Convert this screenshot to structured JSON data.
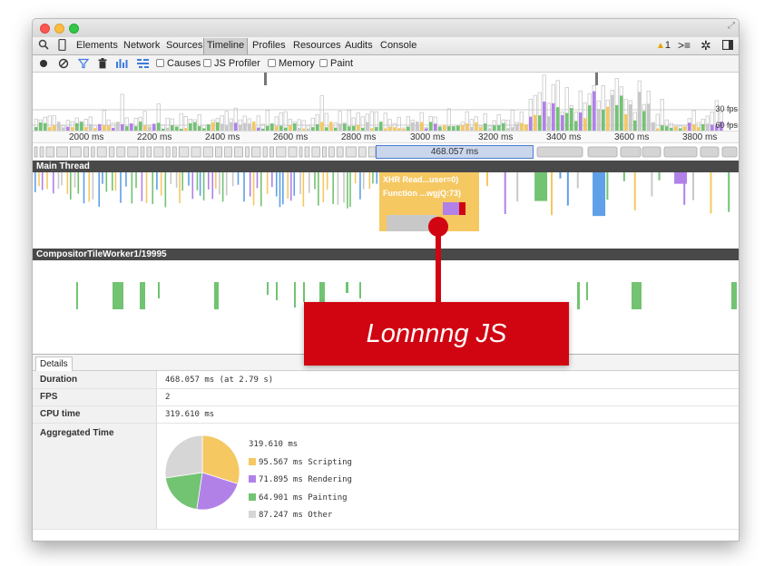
{
  "window": {
    "resize_icon": "resize-icon"
  },
  "tabs": [
    {
      "label": "Elements"
    },
    {
      "label": "Network"
    },
    {
      "label": "Sources"
    },
    {
      "label": "Timeline",
      "selected": true
    },
    {
      "label": "Profiles"
    },
    {
      "label": "Resources"
    },
    {
      "label": "Audits"
    },
    {
      "label": "Console"
    }
  ],
  "tabbar_right": {
    "warning_count": "1",
    "warning_icon": "warning-icon",
    "drawer_icon": "console-drawer-icon",
    "settings_icon": "gear-icon",
    "dock_icon": "dock-icon"
  },
  "toolbar": {
    "record_icon": "record-icon",
    "clear_icon": "clear-icon",
    "filter_icon": "filter-icon",
    "trash_icon": "trash-icon",
    "bars_icon": "bars-icon",
    "flame_icon": "flame-icon",
    "causes": "Causes",
    "js_profiler": "JS Profiler",
    "memory": "Memory",
    "paint": "Paint"
  },
  "overview": {
    "fps_30": "30 fps",
    "fps_60": "60 fps"
  },
  "ruler_ticks": [
    "2000 ms",
    "2200 ms",
    "2400 ms",
    "2600 ms",
    "2800 ms",
    "3000 ms",
    "3200 ms",
    "3400 ms",
    "3600 ms",
    "3800 ms"
  ],
  "selected_frame": "468.057 ms",
  "main_thread": {
    "title": "Main Thread",
    "event1": "XHR Read...user=0)",
    "event2": "Function ...wgjQ:73)"
  },
  "worker_thread": {
    "title": "CompositorTileWorker1/19995"
  },
  "callout": "Lonnnng JS",
  "details": {
    "tab": "Details",
    "duration_label": "Duration",
    "duration_value": "468.057 ms (at 2.79 s)",
    "fps_label": "FPS",
    "fps_value": "2",
    "cpu_label": "CPU time",
    "cpu_value": "319.610 ms",
    "agg_label": "Aggregated Time",
    "agg_total": "319.610 ms",
    "breakdown": [
      {
        "value": "95.567 ms",
        "name": "Scripting",
        "color": "#f5c862",
        "ms": 95.567
      },
      {
        "value": "71.895 ms",
        "name": "Rendering",
        "color": "#b181e8",
        "ms": 71.895
      },
      {
        "value": "64.901 ms",
        "name": "Painting",
        "color": "#72c372",
        "ms": 64.901
      },
      {
        "value": "87.247 ms",
        "name": "Other",
        "color": "#d6d6d6",
        "ms": 87.247
      }
    ]
  },
  "colors": {
    "scripting": "#f5c862",
    "rendering": "#b181e8",
    "painting": "#72c372",
    "loading": "#5fa0e8",
    "callout": "#d10511",
    "selection": "#4c7bd0"
  }
}
